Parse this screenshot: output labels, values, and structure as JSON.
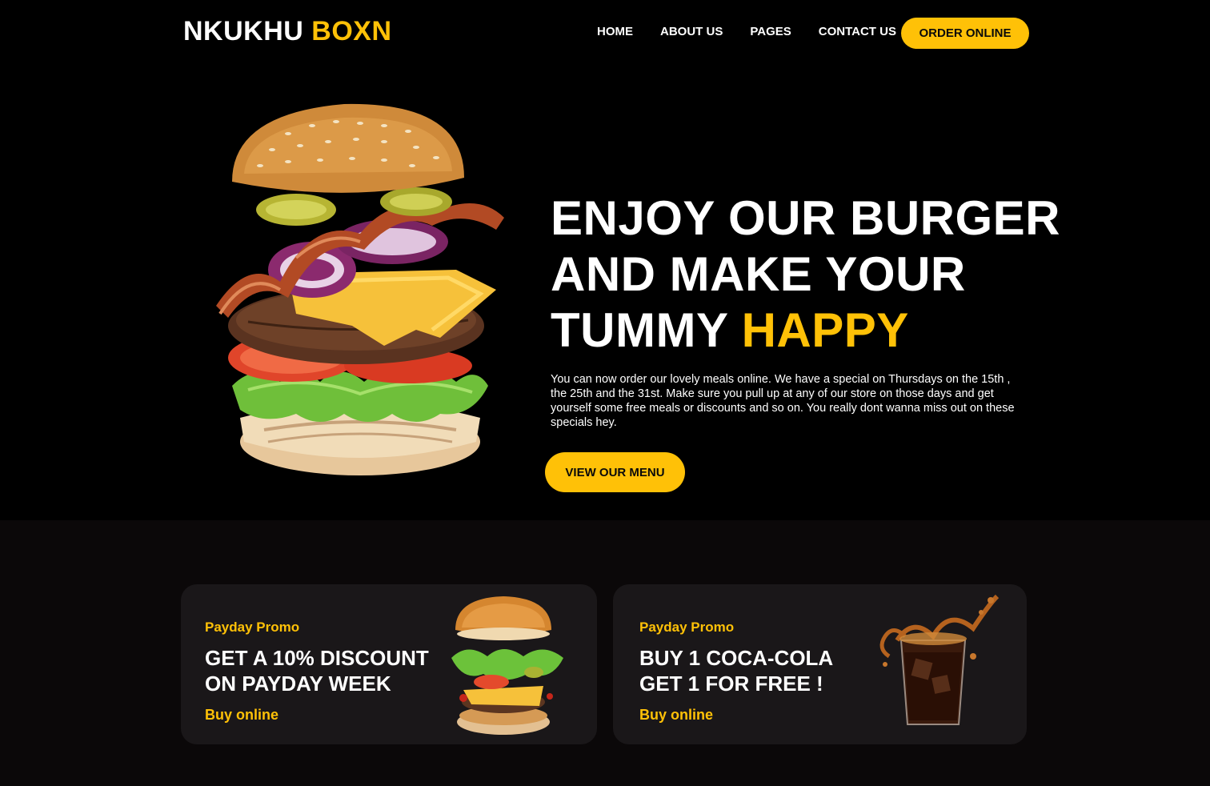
{
  "brand": {
    "name_white": "NKUKHU",
    "name_yellow": "BOXN",
    "accent": "#FFC107"
  },
  "nav": {
    "items": [
      {
        "label": "HOME"
      },
      {
        "label": "ABOUT US"
      },
      {
        "label": "PAGES"
      },
      {
        "label": "CONTACT US"
      }
    ],
    "cta": "ORDER ONLINE"
  },
  "hero": {
    "title_line1": "ENJOY OUR BURGER",
    "title_line2": "AND MAKE YOUR",
    "title_line3_white": "TUMMY",
    "title_line3_yellow": "HAPPY",
    "text": "You can now order our lovely meals online. We have a special on Thursdays on the 15th , the 25th and the 31st. Make sure you pull up at any of our store on those days and get yourself some free meals or discounts and so on. You really dont wanna miss out on these specials hey.",
    "button": "VIEW OUR MENU",
    "image_icon": "burger-image"
  },
  "promos": [
    {
      "eyebrow": "Payday Promo",
      "title_line1": "GET A 10% DISCOUNT",
      "title_line2": "ON PAYDAY WEEK",
      "link": "Buy online",
      "image_icon": "deconstructed-burger-image"
    },
    {
      "eyebrow": "Payday Promo",
      "title_line1": "BUY 1 COCA-COLA",
      "title_line2": "GET 1 FOR FREE !",
      "link": "Buy online",
      "image_icon": "cola-glass-image"
    }
  ]
}
